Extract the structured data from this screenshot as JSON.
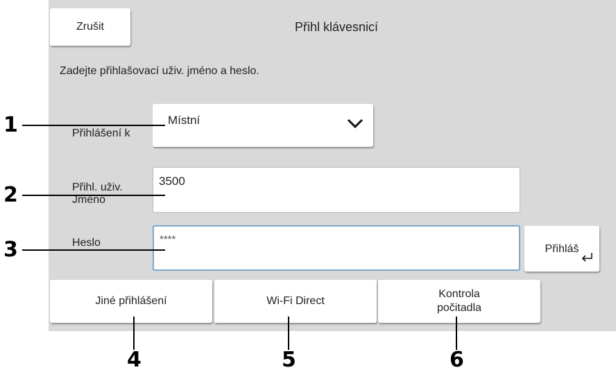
{
  "header": {
    "cancel_label": "Zrušit",
    "title": "Přihl klávesnicí"
  },
  "instruction": "Zadejte přihlašovací uživ. jméno a heslo.",
  "form": {
    "login_to_label": "Přihlášení k",
    "login_to_value": "Místní",
    "username_label_line1": "Přihl. uživ.",
    "username_label_line2": "Jméno",
    "username_value": "3500",
    "password_label": "Heslo",
    "password_value": "****",
    "login_button_label": "Přihláš",
    "login_button_icon": "enter-return-icon"
  },
  "bottom_buttons": {
    "other_login": "Jiné přihlášení",
    "wifi_direct": "Wi-Fi Direct",
    "counter_check_line1": "Kontrola",
    "counter_check_line2": "počitadla"
  },
  "callouts": [
    "1",
    "2",
    "3",
    "4",
    "5",
    "6"
  ]
}
